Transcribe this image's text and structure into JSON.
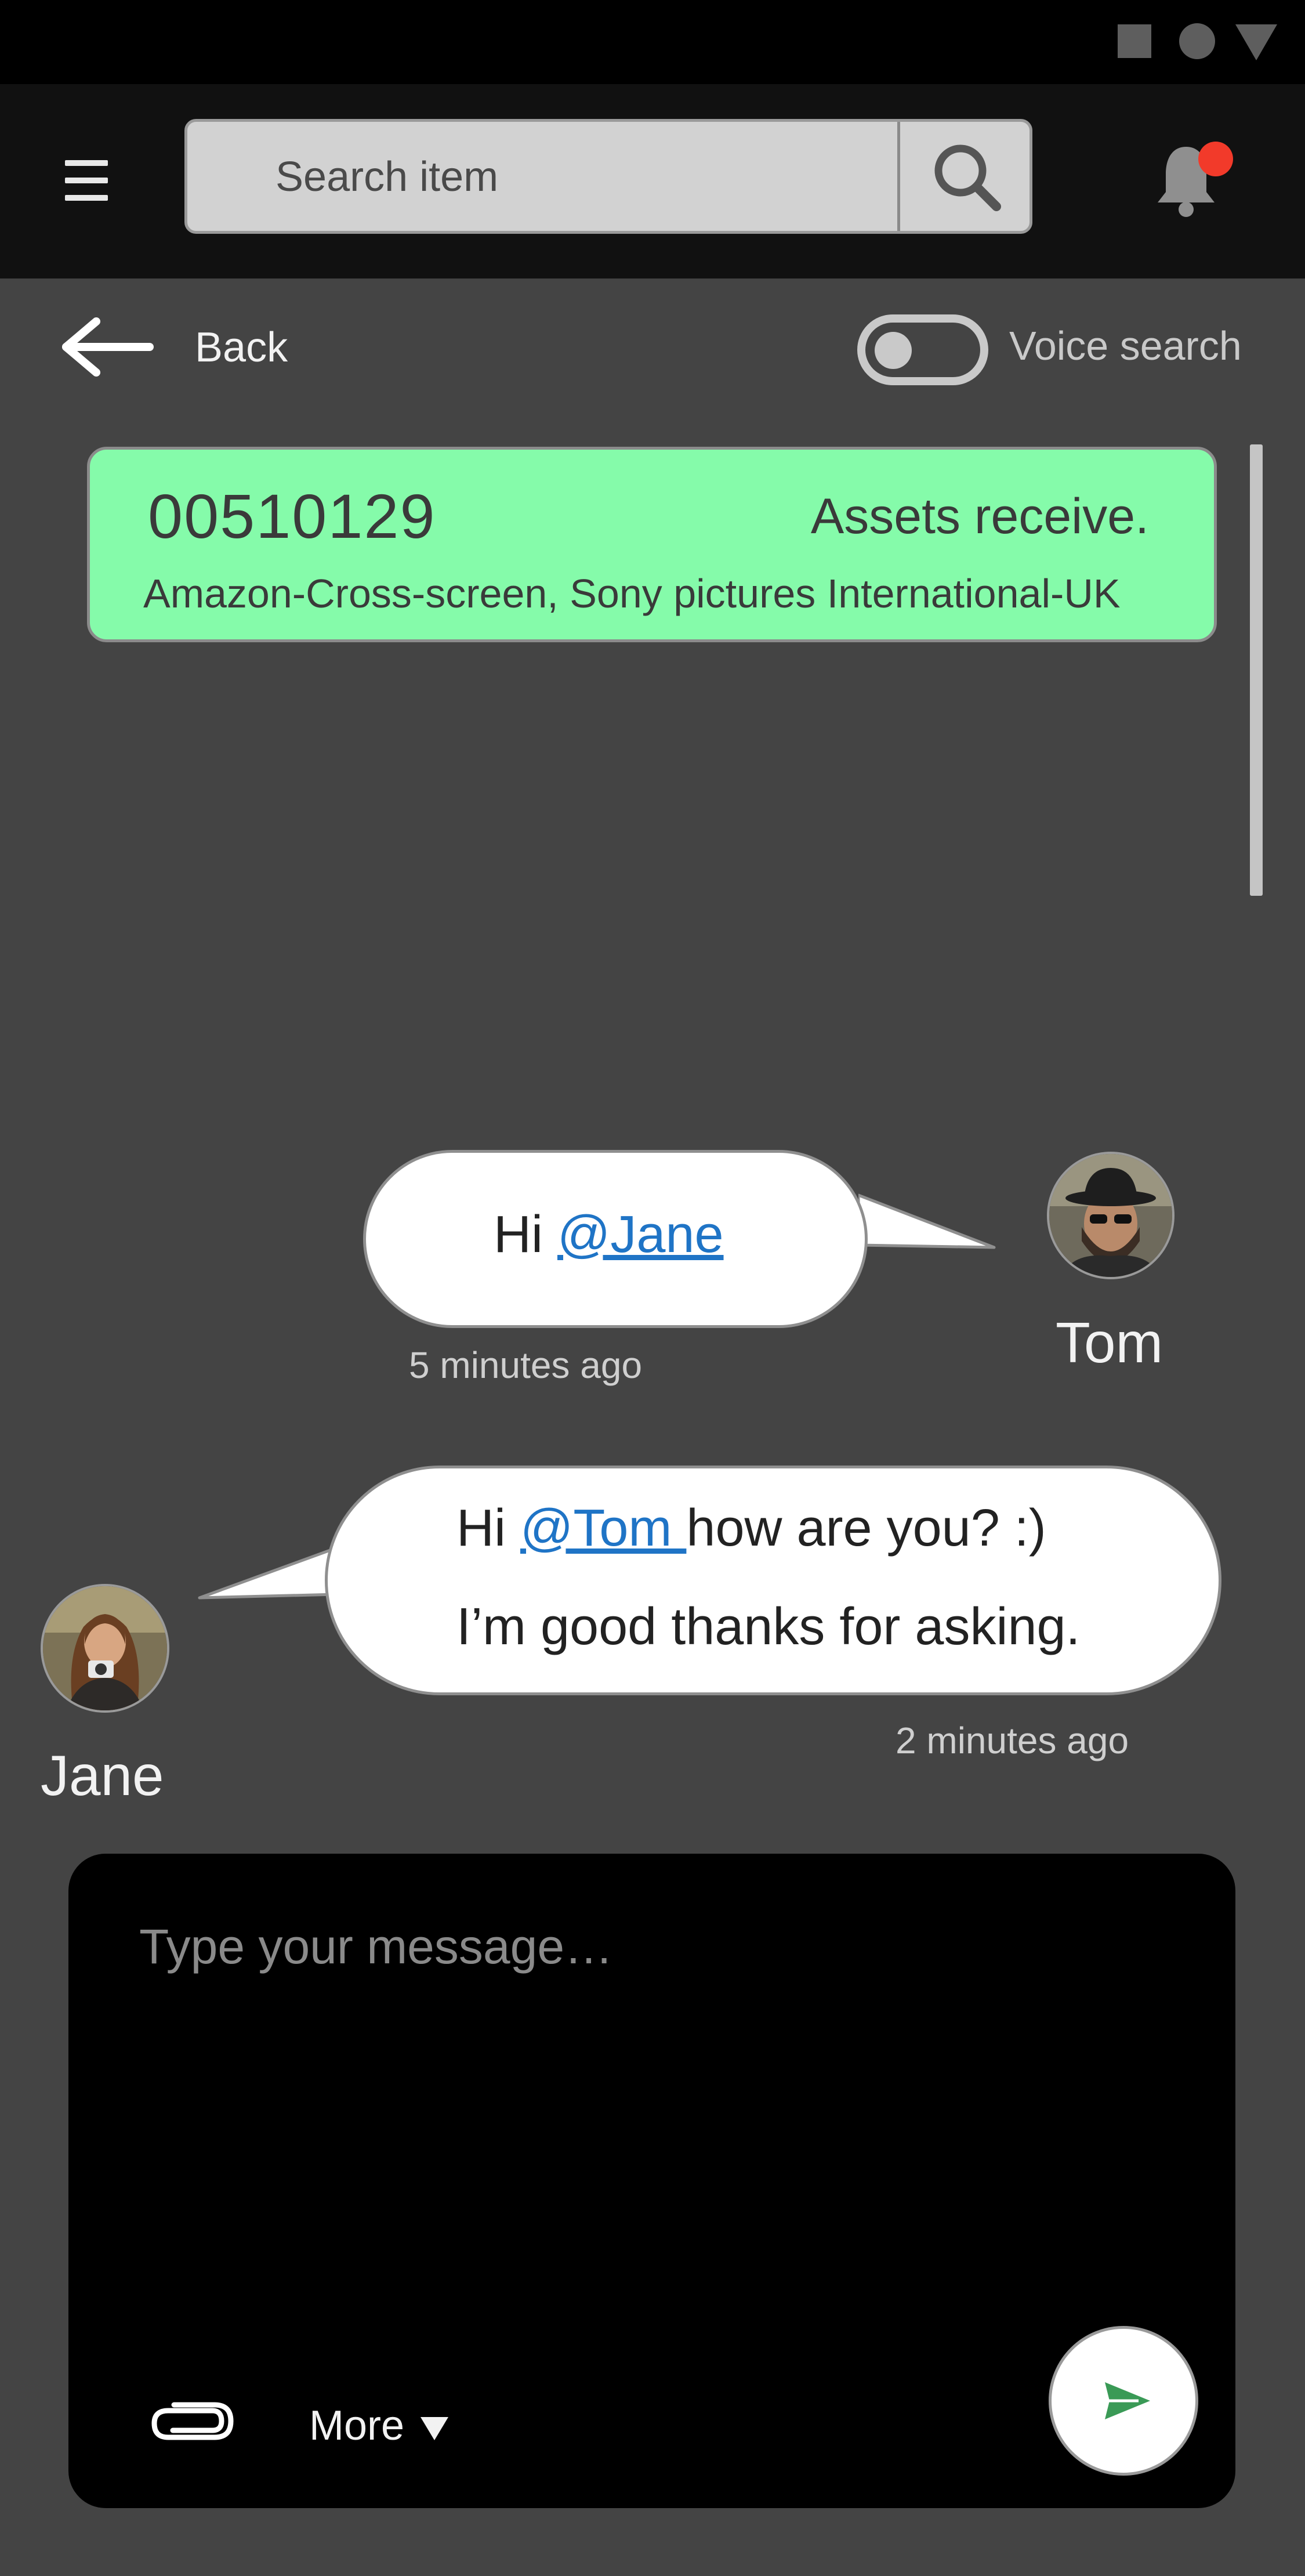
{
  "status_bar": {
    "icons": [
      "square-icon",
      "circle-icon",
      "triangle-icon"
    ]
  },
  "header": {
    "menu_icon": "hamburger-menu-icon",
    "search": {
      "placeholder": "Search item",
      "value": ""
    },
    "search_icon": "search-icon",
    "notification_icon": "bell-icon",
    "notification_badge_color": "#f23a2a"
  },
  "nav": {
    "back_label": "Back",
    "voice_search_label": "Voice search",
    "voice_search_enabled": false
  },
  "info_card": {
    "id": "00510129",
    "status": "Assets receive.",
    "subtitle": "Amazon-Cross-screen, Sony pictures International-UK",
    "color": "#85fbaa"
  },
  "messages": [
    {
      "sender": "Tom",
      "text_prefix": "Hi ",
      "mention": "@Jane",
      "time": "5 minutes ago"
    },
    {
      "sender": "Jane",
      "line1_prefix": "Hi ",
      "mention": "@Tom ",
      "line1_suffix": "how are you?  :)",
      "line2": "I’m good thanks for asking.",
      "time": "2 minutes ago"
    }
  ],
  "composer": {
    "placeholder": "Type your message…",
    "value": "",
    "attach_icon": "paperclip-icon",
    "more_label": "More",
    "send_icon": "send-icon",
    "send_color": "#3a9a56"
  },
  "colors": {
    "background": "#444444",
    "appbar": "#111111",
    "mention": "#1f74c6"
  }
}
